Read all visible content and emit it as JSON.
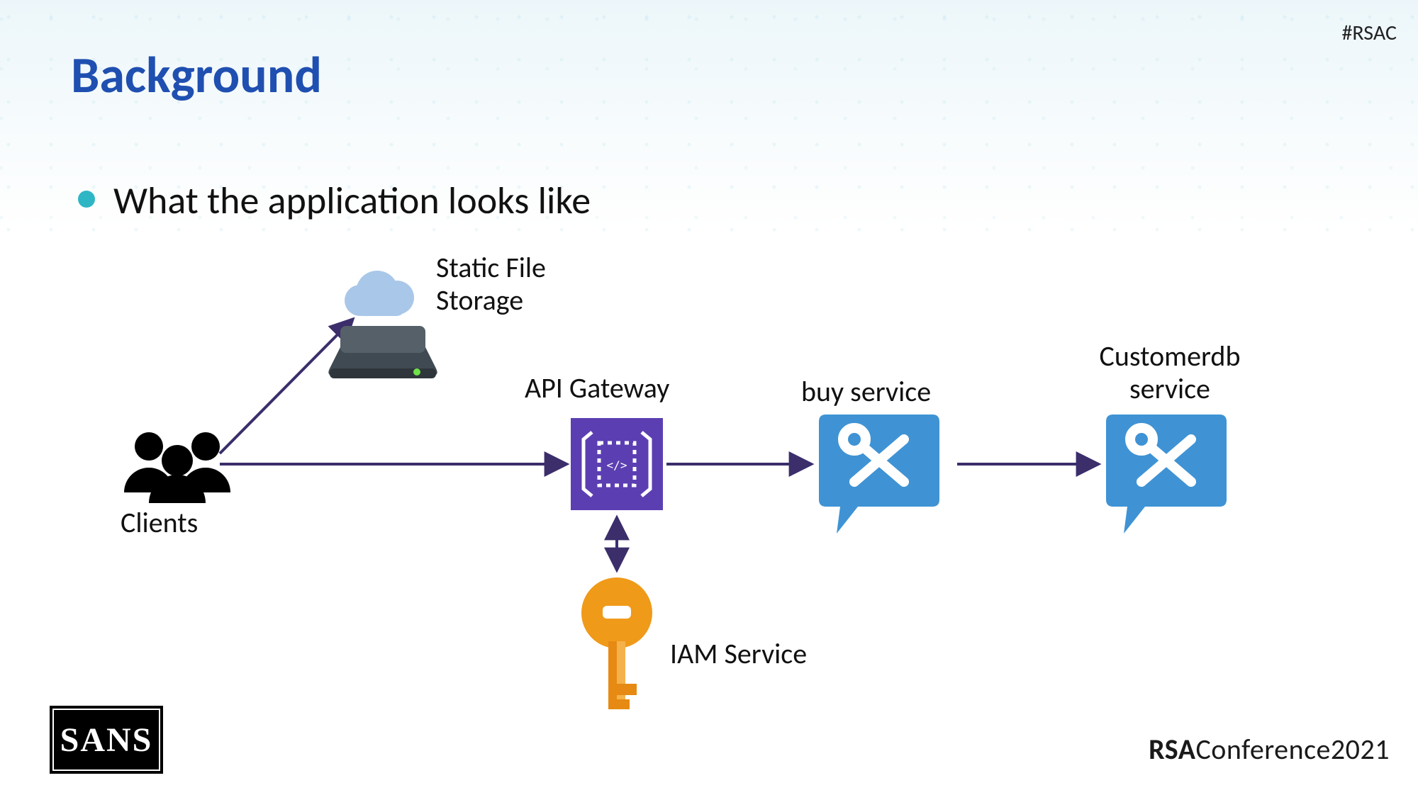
{
  "header": {
    "hashtag": "#RSAC",
    "title": "Background"
  },
  "bullet": {
    "text": "What the application looks like"
  },
  "nodes": {
    "clients": {
      "label": "Clients"
    },
    "storage": {
      "label_line1": "Static File",
      "label_line2": "Storage"
    },
    "api_gateway": {
      "label": "API Gateway"
    },
    "buy_service": {
      "label": "buy service"
    },
    "customerdb": {
      "label_line1": "Customerdb",
      "label_line2": "service"
    },
    "iam": {
      "label": "IAM Service"
    }
  },
  "footer": {
    "sans": "SANS",
    "rsa_bold": "RSA",
    "rsa_light_a": "Conference",
    "rsa_light_b": "2021"
  },
  "diagram_meta": {
    "edges": [
      [
        "clients",
        "storage"
      ],
      [
        "clients",
        "api_gateway"
      ],
      [
        "api_gateway",
        "buy_service"
      ],
      [
        "buy_service",
        "customerdb"
      ],
      [
        "api_gateway",
        "iam",
        "bidirectional"
      ]
    ]
  }
}
